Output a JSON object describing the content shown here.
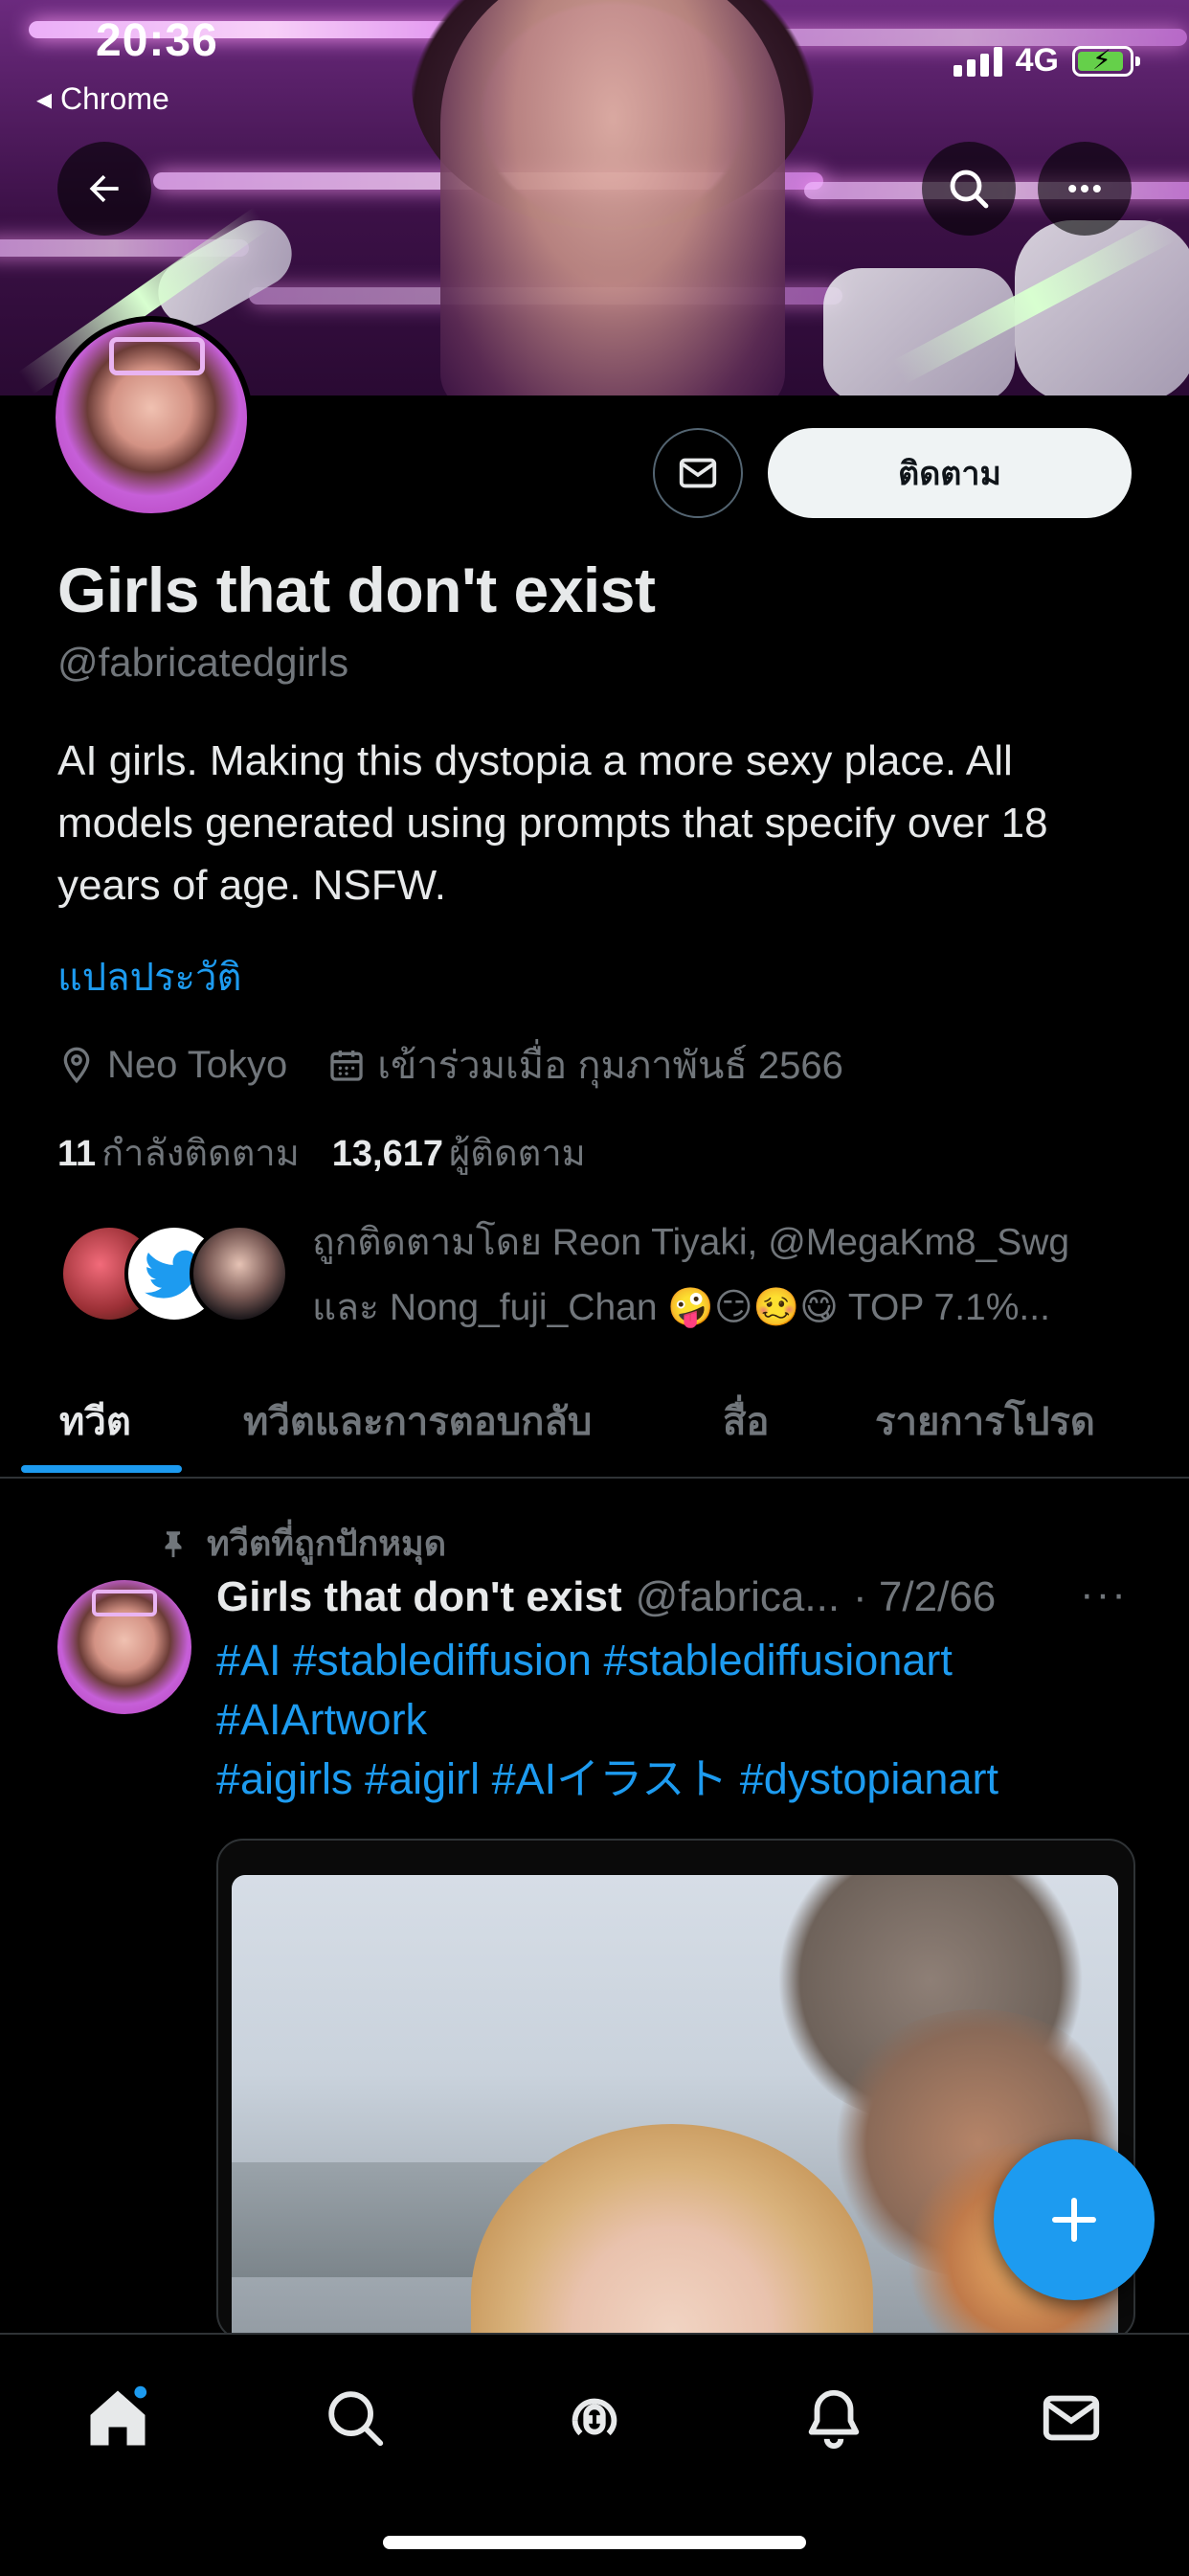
{
  "status_bar": {
    "time": "20:36",
    "back_app": "◂ Chrome",
    "network": "4G"
  },
  "profile": {
    "display_name": "Girls that don't exist",
    "handle": "@fabricatedgirls",
    "bio": "AI girls. Making this dystopia a more sexy place. All models generated using prompts that specify over 18 years of age. NSFW.",
    "translate_bio": "แปลประวัติ",
    "location": "Neo Tokyo",
    "joined": "เข้าร่วมเมื่อ กุมภาพันธ์ 2566",
    "following_count": "11",
    "following_label": "กำลังติดตาม",
    "followers_count": "13,617",
    "followers_label": "ผู้ติดตาม",
    "followed_by_line1": "ถูกติดตามโดย Reon Tiyaki, @MegaKm8_Swg",
    "followed_by_line2": "และ Nong_fuji_Chan 🤪😏🥴😋 TOP 7.1%..."
  },
  "actions": {
    "follow": "ติดตาม"
  },
  "tabs": [
    {
      "label": "ทวีต",
      "active": true
    },
    {
      "label": "ทวีตและการตอบกลับ",
      "active": false
    },
    {
      "label": "สื่อ",
      "active": false
    },
    {
      "label": "รายการโปรด",
      "active": false
    }
  ],
  "pinned_tweet": {
    "pinned_label": "ทวีตที่ถูกปักหมุด",
    "author_name": "Girls that don't exist",
    "author_handle": "@fabrica...",
    "date": "· 7/2/66",
    "more": "···",
    "text_line1": "#AI #stablediffusion #stablediffusionart",
    "text_line2": "#AIArtwork",
    "text_line3": "#aigirls #aigirl #AIイラスト #dystopianart"
  },
  "colors": {
    "accent": "#1d9bf0",
    "background": "#000000",
    "text_primary": "#e7e9ea",
    "text_secondary": "#71767b",
    "follow_button_bg": "#eff3f4"
  },
  "icons": {
    "back": "arrow-left-icon",
    "search": "search-icon",
    "more": "more-horizontal-icon",
    "message": "envelope-icon",
    "location": "map-pin-icon",
    "calendar": "calendar-icon",
    "pin": "pin-icon",
    "compose": "plus-icon",
    "nav": [
      "home-icon",
      "search-icon",
      "spaces-icon",
      "bell-icon",
      "envelope-icon"
    ]
  }
}
